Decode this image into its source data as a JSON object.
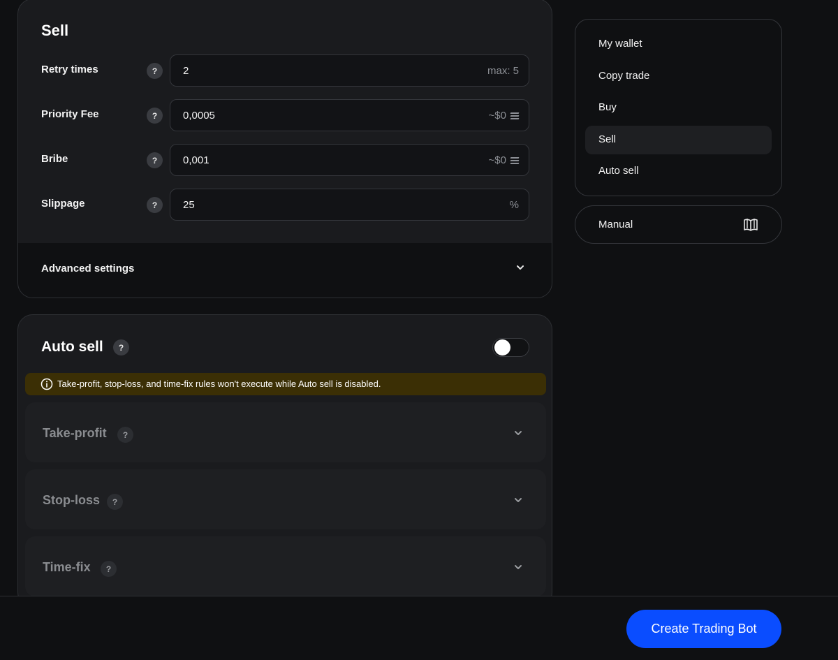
{
  "sell": {
    "title": "Sell",
    "fields": [
      {
        "label": "Retry times",
        "value": "2",
        "suffix": "max: 5",
        "icon": ""
      },
      {
        "label": "Priority Fee",
        "value": "0,0005",
        "suffix": "~$0",
        "icon": "solana-icon"
      },
      {
        "label": "Bribe",
        "value": "0,001",
        "suffix": "~$0",
        "icon": "solana-icon"
      },
      {
        "label": "Slippage",
        "value": "25",
        "suffix": "%",
        "icon": ""
      }
    ],
    "help_glyph": "?",
    "advanced_label": "Advanced settings"
  },
  "auto_sell": {
    "title": "Auto sell",
    "enabled": false,
    "warning": "Take-profit, stop-loss, and time-fix rules won't execute while Auto sell is disabled.",
    "sections": [
      {
        "label": "Take-profit"
      },
      {
        "label": "Stop-loss"
      },
      {
        "label": "Time-fix"
      }
    ]
  },
  "nav": {
    "items": [
      {
        "label": "My wallet",
        "active": false
      },
      {
        "label": "Copy trade",
        "active": false
      },
      {
        "label": "Buy",
        "active": false
      },
      {
        "label": "Sell",
        "active": true
      },
      {
        "label": "Auto sell",
        "active": false
      }
    ],
    "manual_label": "Manual"
  },
  "footer": {
    "create_button": "Create Trading Bot"
  },
  "colors": {
    "accent": "#0a4dff",
    "warning_bg": "#3b2f05",
    "card_bg": "#1a1b1e",
    "page_bg": "#0f1012"
  }
}
